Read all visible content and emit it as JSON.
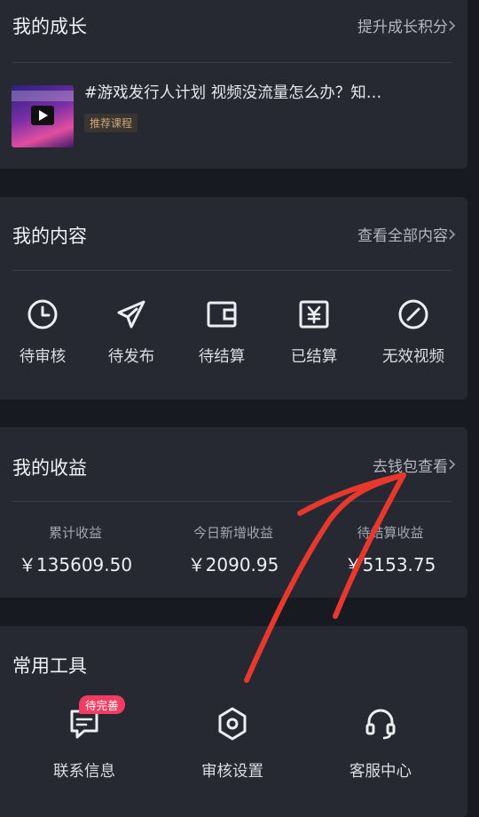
{
  "growth": {
    "title": "我的成长",
    "link": "提升成长积分",
    "course_title": "#游戏发行人计划 视频没流量怎么办？知…",
    "course_tag": "推荐课程"
  },
  "content": {
    "title": "我的内容",
    "link": "查看全部内容",
    "items": [
      {
        "label": "待审核",
        "icon": "clock-icon"
      },
      {
        "label": "待发布",
        "icon": "send-icon"
      },
      {
        "label": "待结算",
        "icon": "wallet-icon"
      },
      {
        "label": "已结算",
        "icon": "yen-icon"
      },
      {
        "label": "无效视频",
        "icon": "invalid-icon"
      }
    ]
  },
  "earnings": {
    "title": "我的收益",
    "link": "去钱包查看",
    "items": [
      {
        "label": "累计收益",
        "value": "￥135609.50"
      },
      {
        "label": "今日新增收益",
        "value": "￥2090.95"
      },
      {
        "label": "待结算收益",
        "value": "￥5153.75"
      }
    ]
  },
  "tools": {
    "title": "常用工具",
    "items": [
      {
        "label": "联系信息",
        "icon": "message-icon",
        "badge": "待完善"
      },
      {
        "label": "审核设置",
        "icon": "hexagon-settings-icon"
      },
      {
        "label": "客服中心",
        "icon": "headset-icon"
      }
    ]
  },
  "colors": {
    "background": "#181a22",
    "card": "#262832",
    "badge": "#f23c62",
    "annotation_arrow": "#e8372c"
  }
}
